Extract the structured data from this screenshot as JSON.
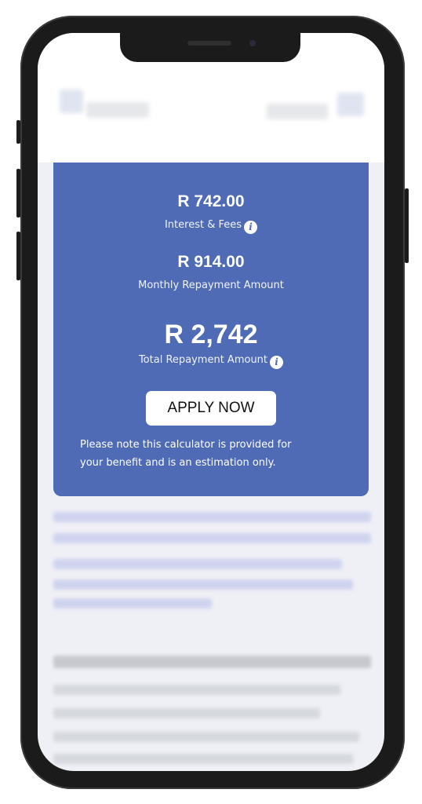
{
  "summary": {
    "interest_amount": "R 742.00",
    "interest_label": "Interest & Fees",
    "monthly_amount": "R 914.00",
    "monthly_label": "Monthly Repayment Amount",
    "total_amount": "R 2,742",
    "total_label": "Total Repayment Amount",
    "info_glyph": "i"
  },
  "apply_button": {
    "label": "APPLY NOW"
  },
  "disclaimer": {
    "line1": "Please note this calculator is provided for",
    "line2": "your benefit and is an estimation only."
  },
  "colors": {
    "card_background": "#4f6bb5",
    "button_background": "#ffffff",
    "phone_frame": "#1b1b1b"
  },
  "icons": {
    "interest_info": "info-icon",
    "total_info": "info-icon"
  }
}
